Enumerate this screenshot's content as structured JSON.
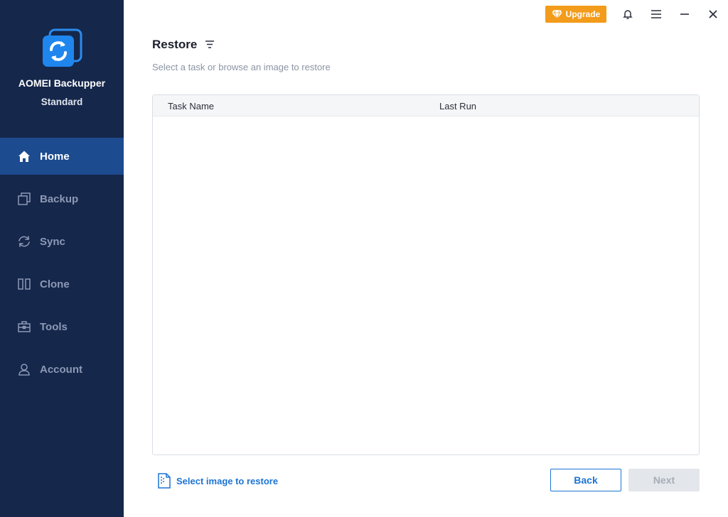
{
  "app": {
    "name": "AOMEI Backupper",
    "edition": "Standard",
    "logo_icon": "sync-logo-icon"
  },
  "sidebar": {
    "items": [
      {
        "label": "Home",
        "icon": "home-icon",
        "active": true
      },
      {
        "label": "Backup",
        "icon": "backup-icon",
        "active": false
      },
      {
        "label": "Sync",
        "icon": "sync-icon",
        "active": false
      },
      {
        "label": "Clone",
        "icon": "clone-icon",
        "active": false
      },
      {
        "label": "Tools",
        "icon": "toolbox-icon",
        "active": false
      },
      {
        "label": "Account",
        "icon": "user-icon",
        "active": false
      }
    ]
  },
  "topbar": {
    "upgrade_label": "Upgrade",
    "icons": [
      "diamond-icon",
      "bell-icon",
      "menu-icon",
      "minimize-icon",
      "close-icon"
    ]
  },
  "main": {
    "title": "Restore",
    "subtitle": "Select a task or browse an image to restore",
    "table": {
      "columns": [
        "Task Name",
        "Last Run"
      ],
      "rows": []
    },
    "select_image_label": "Select image to restore",
    "back_label": "Back",
    "next_label": "Next"
  },
  "colors": {
    "sidebar_bg": "#15274b",
    "active_nav_bg": "#1d4b8f",
    "accent": "#1c74d4",
    "upgrade": "#f39b1b"
  }
}
